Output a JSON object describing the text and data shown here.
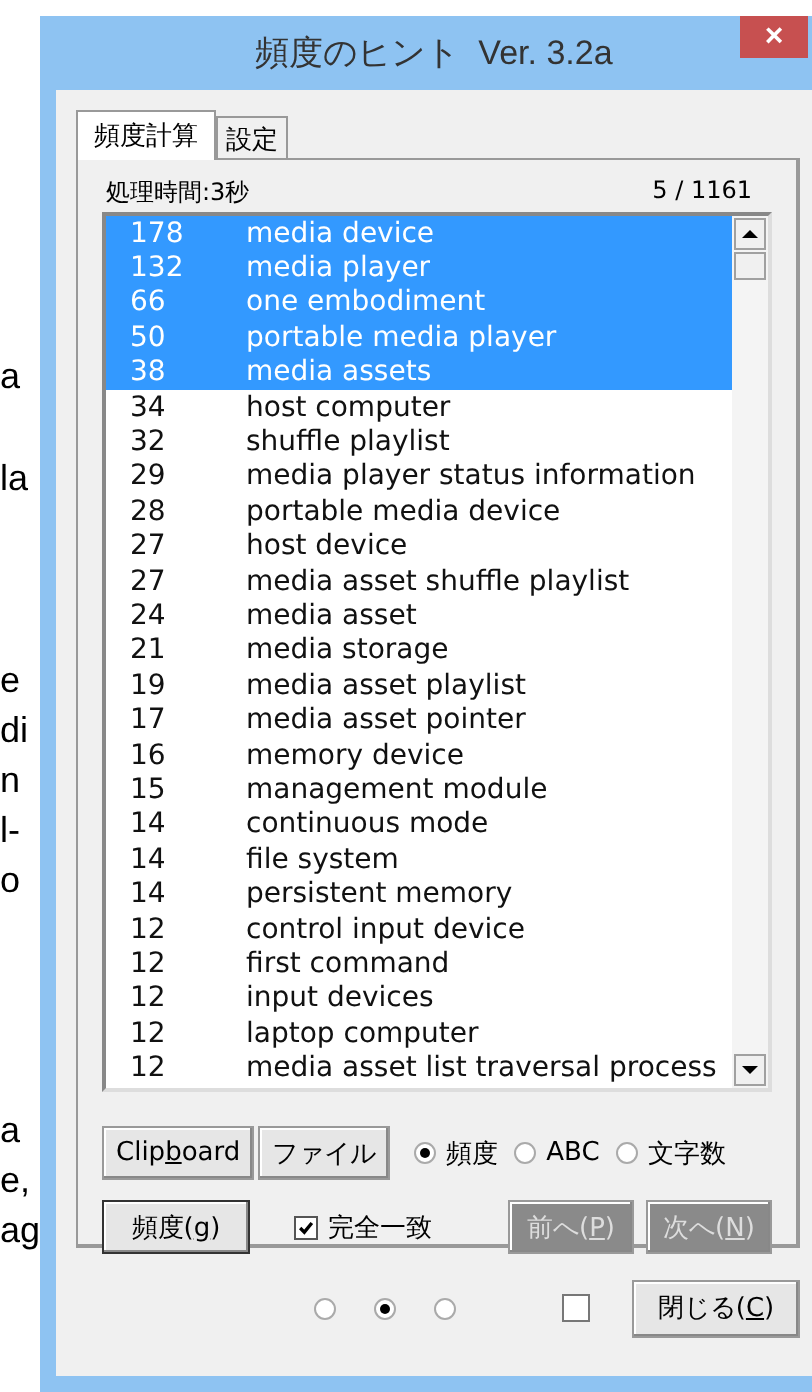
{
  "background_document": {
    "paragraphs": [
      [
        "a"
      ],
      [
        "la"
      ],
      [
        "e",
        "di",
        "n",
        "l-",
        "o"
      ],
      [
        "a",
        "e,",
        "ag"
      ]
    ]
  },
  "window": {
    "title": "頻度のヒント  Ver. 3.2a",
    "close": "×"
  },
  "tabs": [
    {
      "label": "頻度計算",
      "selected": true
    },
    {
      "label": "設定",
      "selected": false
    }
  ],
  "processing_time": "処理時間:3秒",
  "count": "5 / 1161",
  "list": {
    "rows": [
      {
        "count": "178",
        "term": "media device",
        "selected": true
      },
      {
        "count": "132",
        "term": "media player",
        "selected": true
      },
      {
        "count": "66",
        "term": "one embodiment",
        "selected": true
      },
      {
        "count": "50",
        "term": "portable media player",
        "selected": true
      },
      {
        "count": "38",
        "term": "media assets",
        "selected": true
      },
      {
        "count": "34",
        "term": "host computer",
        "selected": false
      },
      {
        "count": "32",
        "term": "shuffle playlist",
        "selected": false
      },
      {
        "count": "29",
        "term": "media player status information",
        "selected": false
      },
      {
        "count": "28",
        "term": "portable media device",
        "selected": false
      },
      {
        "count": "27",
        "term": "host device",
        "selected": false
      },
      {
        "count": "27",
        "term": "media asset shuffle playlist",
        "selected": false
      },
      {
        "count": "24",
        "term": "media asset",
        "selected": false
      },
      {
        "count": "21",
        "term": "media storage",
        "selected": false
      },
      {
        "count": "19",
        "term": "media asset playlist",
        "selected": false
      },
      {
        "count": "17",
        "term": "media asset pointer",
        "selected": false
      },
      {
        "count": "16",
        "term": "memory device",
        "selected": false
      },
      {
        "count": "15",
        "term": "management module",
        "selected": false
      },
      {
        "count": "14",
        "term": "continuous mode",
        "selected": false
      },
      {
        "count": "14",
        "term": "file system",
        "selected": false
      },
      {
        "count": "14",
        "term": "persistent memory",
        "selected": false
      },
      {
        "count": "12",
        "term": "control input device",
        "selected": false
      },
      {
        "count": "12",
        "term": "first command",
        "selected": false
      },
      {
        "count": "12",
        "term": "input devices",
        "selected": false
      },
      {
        "count": "12",
        "term": "laptop computer",
        "selected": false
      },
      {
        "count": "12",
        "term": "media asset list traversal process",
        "selected": false
      }
    ]
  },
  "export_buttons": [
    {
      "before": "Clip",
      "mnemonic": "b",
      "after": "oard",
      "disabled": false
    },
    {
      "before": "ファイル",
      "disabled": false
    }
  ],
  "sort_options": [
    {
      "label": "頻度",
      "selected": true
    },
    {
      "label": "ABC",
      "selected": false
    },
    {
      "label": "文字数",
      "selected": false
    }
  ],
  "frequency_button": {
    "before": "頻度(",
    "mnemonic": "g",
    "after": ")",
    "disabled": false
  },
  "exact_match": {
    "label": "完全一致",
    "checked": true
  },
  "nav_buttons": [
    {
      "before": "前へ(",
      "mnemonic": "P",
      "after": ")",
      "disabled": true
    },
    {
      "before": "次へ(",
      "mnemonic": "N",
      "after": ")",
      "disabled": true
    }
  ],
  "footer_radios": [
    {
      "selected": false
    },
    {
      "selected": true
    },
    {
      "selected": false
    }
  ],
  "footer_checkbox": {
    "checked": false
  },
  "close_button": {
    "before": "閉じる(",
    "mnemonic": "C",
    "after": ")",
    "disabled": false
  }
}
